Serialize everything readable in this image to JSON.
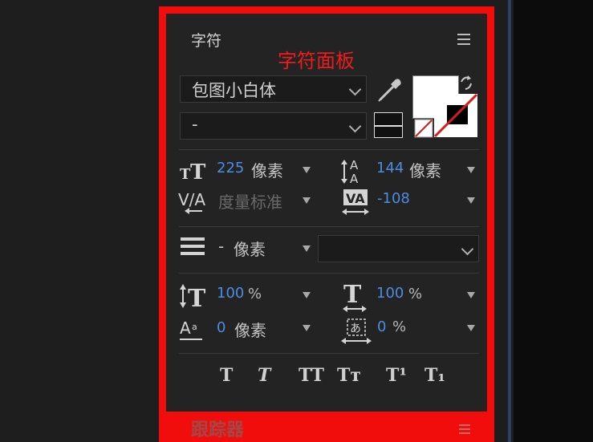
{
  "panel": {
    "title": "字符",
    "annotation": "字符面板",
    "footer_title": "跟踪器"
  },
  "font": {
    "family": "包图小白体",
    "style": "-"
  },
  "metrics": {
    "font_size_value": "225",
    "font_size_unit": "像素",
    "leading_value": "144",
    "leading_unit": "像素",
    "kerning_label": "度量标准",
    "tracking_value": "-108"
  },
  "stroke": {
    "width_value": "-",
    "width_unit": "像素",
    "type": ""
  },
  "scale": {
    "vertical_value": "100",
    "vertical_unit": "%",
    "horizontal_value": "100",
    "horizontal_unit": "%",
    "baseline_value": "0",
    "baseline_unit": "像素",
    "tsume_value": "0",
    "tsume_unit": "%"
  },
  "style_buttons": [
    "T",
    "T",
    "TT",
    "Tт",
    "T¹",
    "T₁"
  ],
  "colors": {
    "annotation": "#f21b1b",
    "frame": "#f20d0d",
    "value_blue": "#4a8ee2",
    "fill_color": "#ffffff",
    "stroke_color": "#000000"
  }
}
